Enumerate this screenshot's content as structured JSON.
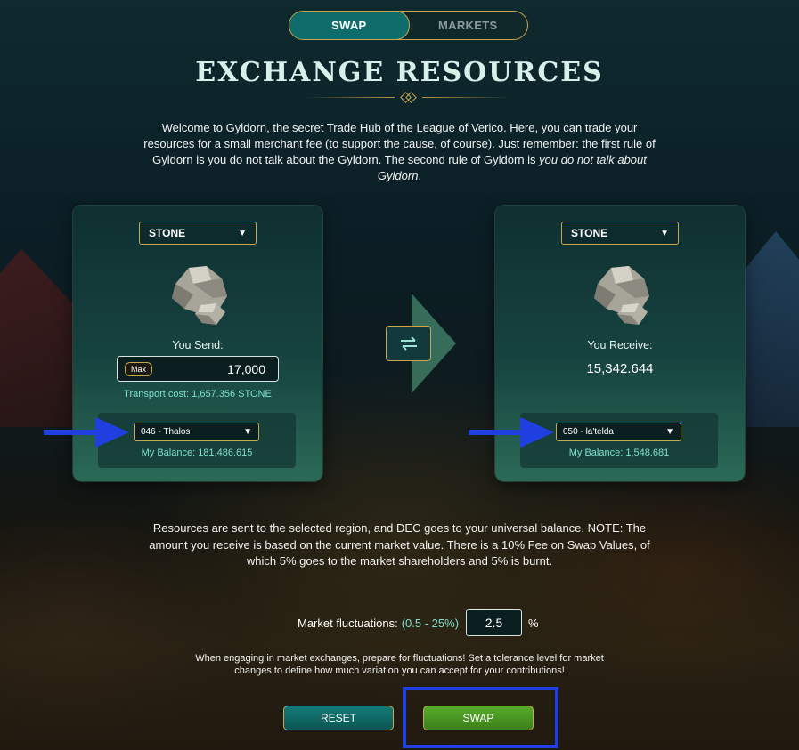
{
  "tabs": {
    "swap": "SWAP",
    "markets": "MARKETS"
  },
  "title": "EXCHANGE RESOURCES",
  "intro": {
    "text": "Welcome to Gyldorn, the secret Trade Hub of the League of Verico. Here, you can trade your resources for a small merchant fee (to support the cause, of course). Just remember: the first rule of Gyldorn is you do not talk about the Gyldorn. The second rule of Gyldorn is ",
    "emphasis": "you do not talk about Gyldorn",
    "end": "."
  },
  "send_panel": {
    "resource": "STONE",
    "label": "You Send:",
    "max_label": "Max",
    "amount": "17,000",
    "transport_cost": "Transport cost: 1,657.356 STONE",
    "region": "046 - Thalos",
    "balance": "My Balance: 181,486.615"
  },
  "receive_panel": {
    "resource": "STONE",
    "label": "You Receive:",
    "amount": "15,342.644",
    "region": "050 - la'telda",
    "balance": "My Balance: 1,548.681"
  },
  "note": "Resources are sent to the selected region, and DEC goes to your universal balance. NOTE: The amount you receive is based on the current market value. There is a 10% Fee on Swap Values, of which 5% goes to the market shareholders and 5% is burnt.",
  "fluctuation": {
    "label": "Market fluctuations:",
    "range": "(0.5 - 25%)",
    "value": "2.5",
    "unit": "%"
  },
  "tolerance_text": "When engaging in market exchanges, prepare for fluctuations! Set a tolerance level for market changes to define how much variation you can accept for your contributions!",
  "buttons": {
    "reset": "RESET",
    "swap": "SWAP"
  },
  "colors": {
    "accent_gold": "#c9a74e",
    "teal": "#0e6d6a",
    "swap_green": "#4f9e25",
    "annotation_blue": "#1f3fe0"
  }
}
